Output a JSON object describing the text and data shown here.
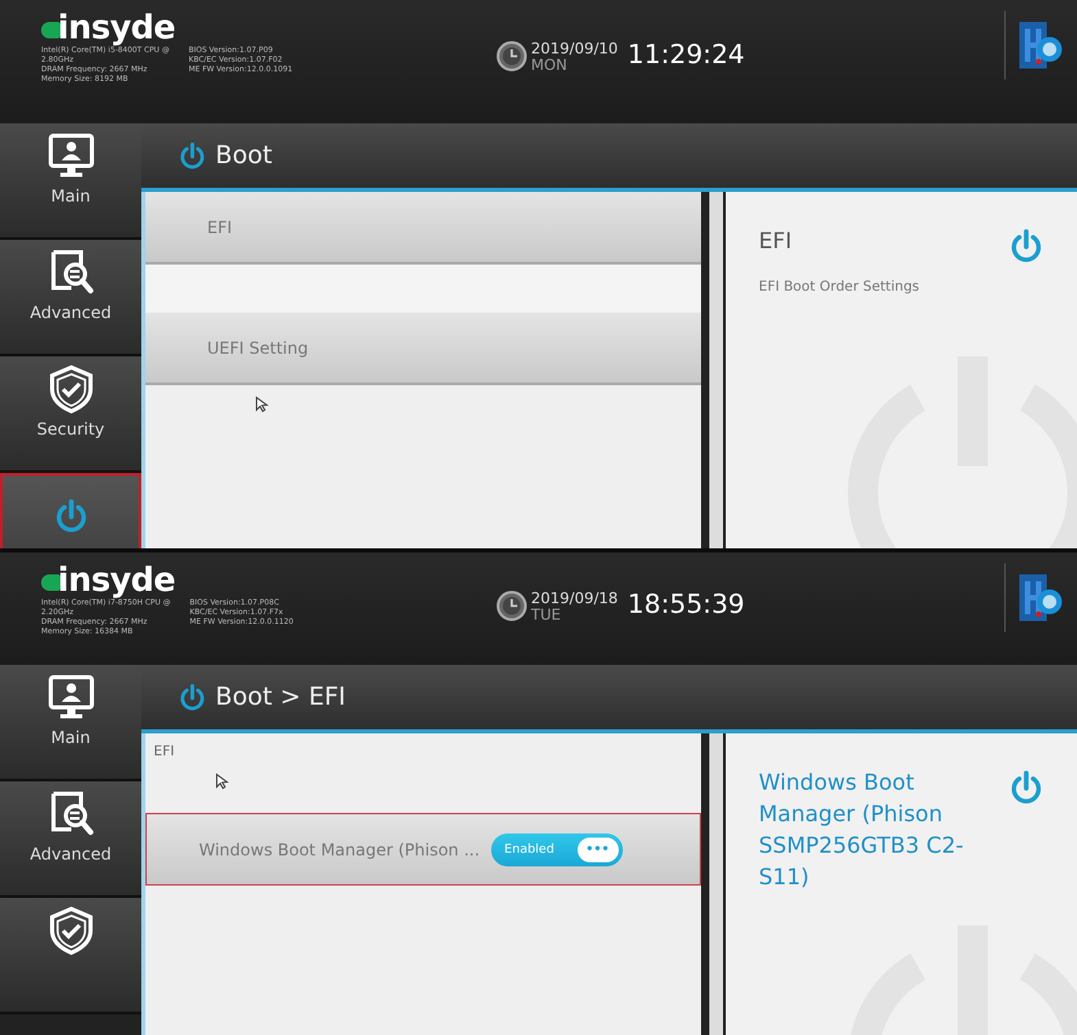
{
  "screens": [
    {
      "header": {
        "logo": "insyde",
        "system_info": [
          "Intel(R) Core(TM) i5-8400T CPU @",
          "2.80GHz",
          "DRAM Frequency: 2667 MHz",
          "Memory Size: 8192 MB"
        ],
        "bios_info": [
          "BIOS Version:1.07.P09",
          "KBC/EC Version:1.07.F02",
          "ME FW Version:12.0.0.1091"
        ],
        "date": "2019/09/10",
        "day": "MON",
        "time": "11:29:24"
      },
      "sidebar": [
        {
          "kind": "monitor",
          "label": "Main",
          "selected": false
        },
        {
          "kind": "search",
          "label": "Advanced",
          "selected": false
        },
        {
          "kind": "shield",
          "label": "Security",
          "selected": false
        },
        {
          "kind": "power",
          "selected": true
        }
      ],
      "breadcrumb": "Boot",
      "items": [
        {
          "kind": "row",
          "label": "EFI",
          "selected": false
        },
        {
          "kind": "spacer"
        },
        {
          "kind": "row",
          "label": "UEFI Setting",
          "selected": false
        }
      ],
      "help": {
        "title": "EFI",
        "description": "EFI Boot Order Settings"
      }
    },
    {
      "header": {
        "logo": "insyde",
        "system_info": [
          "Intel(R) Core(TM) i7-8750H CPU @",
          "2.20GHz",
          "DRAM Frequency: 2667 MHz",
          "Memory Size: 16384 MB"
        ],
        "bios_info": [
          "BIOS Version:1.07.P08C",
          "KBC/EC Version:1.07.F7x",
          "ME FW Version:12.0.0.1120"
        ],
        "date": "2019/09/18",
        "day": "TUE",
        "time": "18:55:39"
      },
      "sidebar": [
        {
          "kind": "monitor",
          "label": "Main",
          "selected": false
        },
        {
          "kind": "search",
          "label": "Advanced",
          "selected": false
        },
        {
          "kind": "shield",
          "selected": false
        }
      ],
      "breadcrumb": "Boot > EFI",
      "items": [
        {
          "kind": "section",
          "label": "EFI"
        },
        {
          "kind": "toggle",
          "label": "Windows Boot Manager (Phison ...",
          "value": "Enabled",
          "on": true,
          "more": "•••",
          "selected": true
        }
      ],
      "help": {
        "title": "Windows Boot Manager (Phison SSMP256GTB3 C2-S11)"
      }
    }
  ]
}
